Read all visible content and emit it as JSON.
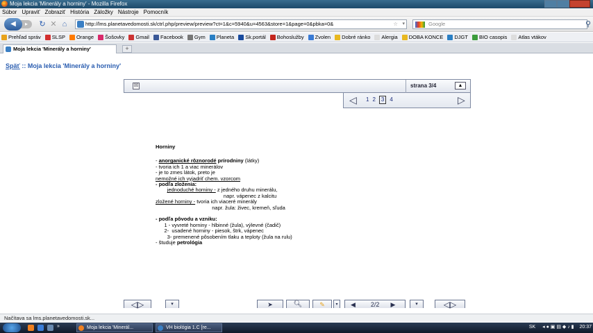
{
  "window": {
    "title": "Moja lekcia 'Minerály a horniny' - Mozilla Firefox"
  },
  "menu": [
    "Súbor",
    "Upraviť",
    "Zobraziť",
    "História",
    "Záložky",
    "Nástroje",
    "Pomocník"
  ],
  "nav": {
    "url": "http://lms.planetavedomosti.sk/ctrl.php/preview/preview?ct=1&c=5940&u=4563&store=1&page=0&pbka=0&",
    "search_placeholder": "Google"
  },
  "bookmarks": [
    {
      "label": "Prehľad správ",
      "color": "#e8a21a"
    },
    {
      "label": "SLSP",
      "color": "#d22f2f"
    },
    {
      "label": "Orange",
      "color": "#ff7a00"
    },
    {
      "label": "Šošovky",
      "color": "#d92a6b"
    },
    {
      "label": "Gmail",
      "color": "#c33"
    },
    {
      "label": "Facebook",
      "color": "#3b5998"
    },
    {
      "label": "Gym",
      "color": "#777"
    },
    {
      "label": "Planeta",
      "color": "#2a7fc4"
    },
    {
      "label": "Sk.portál",
      "color": "#1a4b9e"
    },
    {
      "label": "Bohoslužby",
      "color": "#c4261d"
    },
    {
      "label": "Zvolen",
      "color": "#3a7bd5"
    },
    {
      "label": "Dobré ránko",
      "color": "#e8b820"
    },
    {
      "label": "Alergia",
      "color": "#ddd"
    },
    {
      "label": "DOBA KONCE",
      "color": "#e8b820"
    },
    {
      "label": "DJGT",
      "color": "#2a7fc4"
    },
    {
      "label": "BIO casopis",
      "color": "#3c9c3c"
    },
    {
      "label": "Atlas vtákov",
      "color": "#ddd"
    }
  ],
  "tab": {
    "label": "Moja lekcia 'Minerály a horniny'",
    "new_tab": "+"
  },
  "page": {
    "back_link": "Späť",
    "separator": " :: ",
    "title": "Moja lekcia 'Minerály a horniny'",
    "close_glyph": "☒",
    "page_label": "strana  3/4",
    "up_glyph": "▲",
    "prev_glyph": "◁",
    "next_glyph": "▷",
    "pages": [
      "1",
      "2",
      "3",
      "4"
    ],
    "current_page": "3"
  },
  "lesson": {
    "heading": "Horniny",
    "lines": [
      {
        "pre": "- ",
        "u": "anorganické rôznorodé",
        "b": " prírodniny",
        "post": " (látky)"
      },
      {
        "pre": "- tvoria ich 1 a viac minerálov"
      },
      {
        "pre": "- je to zmes látok, preto je"
      },
      {
        "u2": "nemožné ich vyjadriť chem. vzorcom"
      },
      {
        "b": "- podľa zloženia:"
      },
      {
        "pre": "        ",
        "u2": "jednoduché horniny -",
        "post": " z jedného druhu minerálu,"
      },
      {
        "pre": "                                               napr. vápenec z kalcitu"
      },
      {
        "u2": "zložené horniny -",
        "post": " tvoria ich viaceré minerály"
      },
      {
        "pre": "                                       napr. žula: živec, kremeň, sľuda"
      },
      {
        "pre": " "
      },
      {
        "b": "- podľa pôvodu a vzniku:"
      },
      {
        "pre": "      1 - vyvreté horniny - hlbinné (žula), výlevné (čadič)"
      },
      {
        "pre": "      2-  usadené horniny - piesok, štrk, vápenec"
      },
      {
        "pre": "        3- premenené pôsobením tlaku a teploty (žula na rulu)"
      },
      {
        "pre": "- študuje ",
        "b": "petrológia"
      }
    ]
  },
  "bottom": {
    "counter": "2/2"
  },
  "status": "Načítava sa lms.planetavedomosti.sk...",
  "taskbar": {
    "items": [
      "Moja lekcia 'Minerál...",
      "VH biológia 1.C [re..."
    ],
    "lang": "SK",
    "time": "20:37"
  }
}
